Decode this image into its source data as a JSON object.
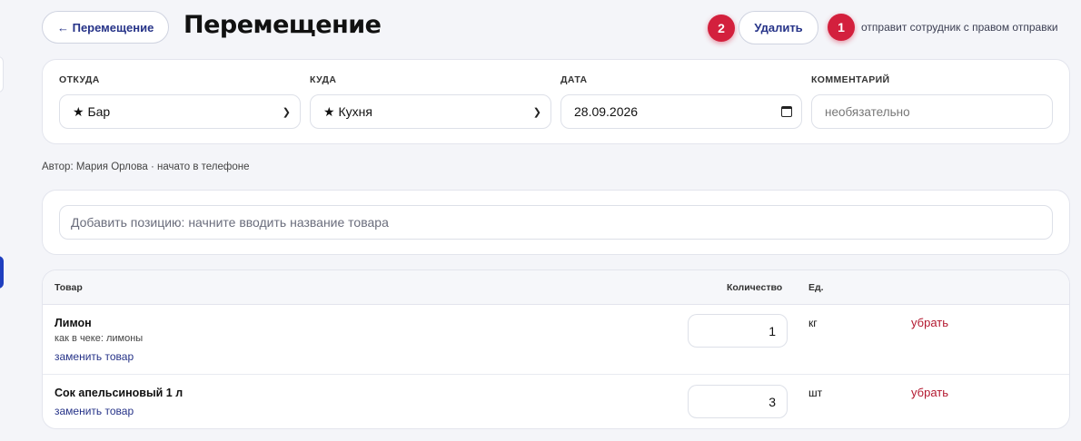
{
  "header": {
    "back_label": "← Перемещение",
    "title": "Перемещение",
    "delete_label": "Удалить",
    "badge_delete": "2",
    "badge_hint": "1",
    "hint_text": "отправит сотрудник с правом отправки"
  },
  "form": {
    "from_label": "ОТКУДА",
    "from_value": "★ Бар",
    "to_label": "КУДА",
    "to_value": "★ Кухня",
    "date_label": "ДАТА",
    "date_value": "28.09.2026",
    "comment_label": "КОММЕНТАРИЙ",
    "comment_placeholder": "необязательно"
  },
  "author_text": "Автор: Мария Орлова · начато в телефоне",
  "search": {
    "placeholder": "Добавить позицию: начните вводить название товара"
  },
  "table": {
    "col_product": "Товар",
    "col_qty": "Количество",
    "col_unit": "Ед.",
    "rows": [
      {
        "name": "Лимон",
        "receipt_note": "как в чеке: лимоны",
        "replace_label": "заменить товар",
        "qty": "1",
        "unit": "кг",
        "remove_label": "убрать"
      },
      {
        "name": "Сок апельсиновый 1 л",
        "replace_label": "заменить товар",
        "qty": "3",
        "unit": "шт",
        "remove_label": "убрать"
      }
    ]
  },
  "colors": {
    "accent": "#263388",
    "badge": "#d3203d",
    "danger": "#b3172e",
    "background": "#f4f5f9"
  }
}
